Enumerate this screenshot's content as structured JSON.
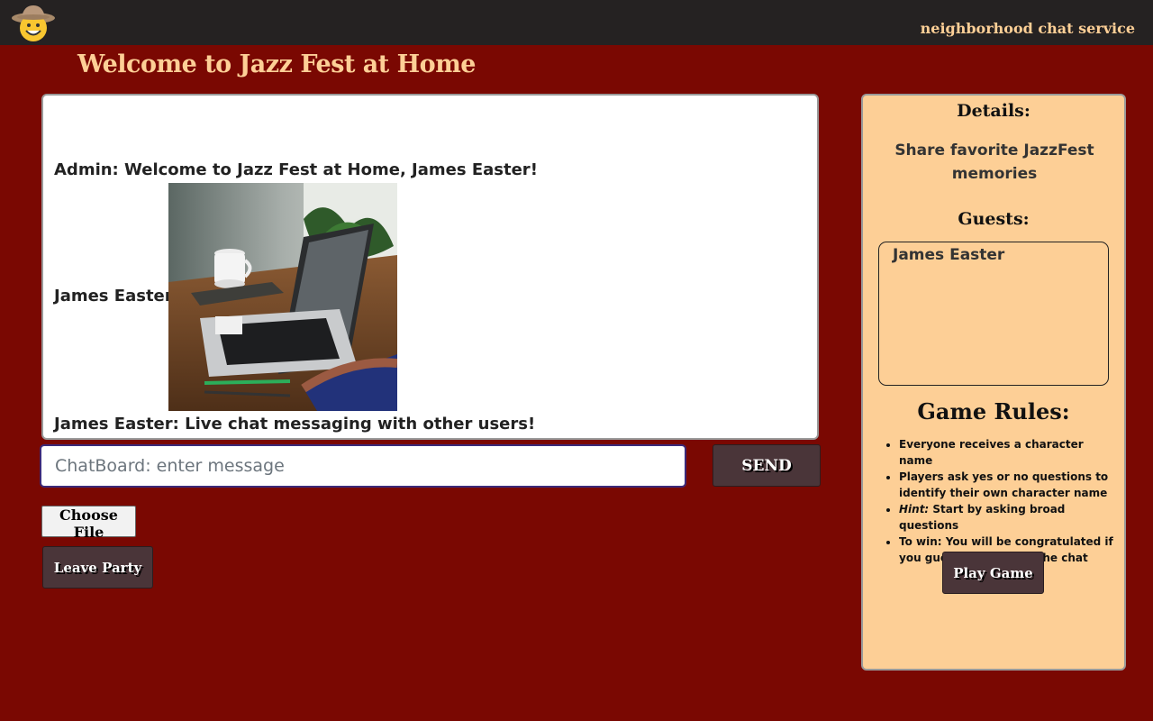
{
  "header": {
    "logo_icon": "cowboy-emoji-icon",
    "service_name": "neighborhood chat service"
  },
  "page": {
    "title": "Welcome to Jazz Fest at Home"
  },
  "chat": {
    "messages": [
      {
        "text": "Admin: Welcome to Jazz Fest at Home, James Easter!"
      },
      {
        "text": "James Easter:",
        "attachment": "photo of laptop, coffee mug and hat on wooden desk"
      },
      {
        "text": "James Easter: Live chat messaging with other users!"
      }
    ],
    "input_placeholder": "ChatBoard: enter message",
    "input_value": "",
    "send_label": "SEND",
    "choose_file_label": "Choose File",
    "leave_label": "Leave Party"
  },
  "sidebar": {
    "details_heading": "Details:",
    "details_text": "Share favorite JazzFest memories",
    "guests_heading": "Guests:",
    "guests": [
      "James Easter"
    ],
    "rules_heading": "Game Rules:",
    "rules": [
      {
        "text": "Everyone receives a character name"
      },
      {
        "text": "Players ask yes or no questions to identify their own character name"
      },
      {
        "prefix": "Hint:",
        "text": " Start by asking broad questions"
      },
      {
        "text": "To win: You will be congratulated if you guess correctly in the chat"
      }
    ],
    "play_label": "Play Game"
  },
  "colors": {
    "background": "#7a0802",
    "topbar": "#252222",
    "accent": "#fdcf96",
    "button": "#4a3539"
  }
}
